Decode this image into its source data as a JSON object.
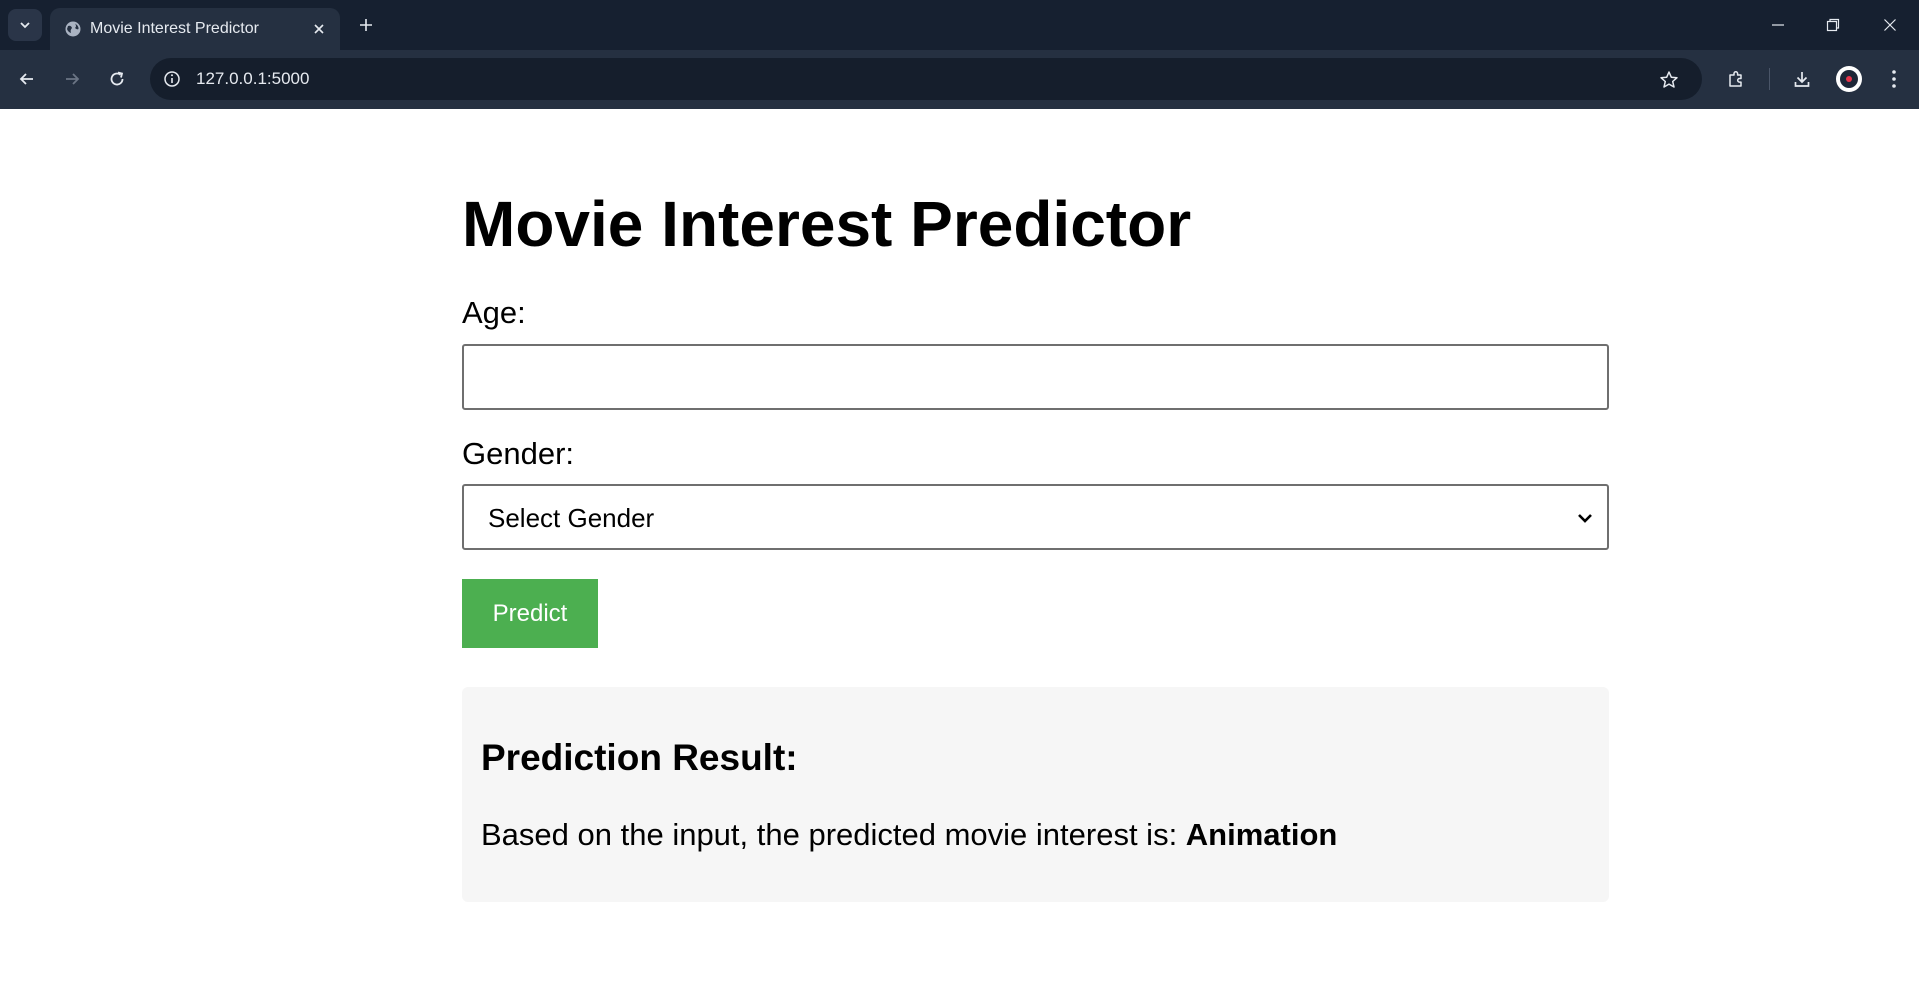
{
  "browser": {
    "tab": {
      "title": "Movie Interest Predictor",
      "favicon": "globe-icon"
    },
    "address_bar": {
      "url": "127.0.0.1:5000"
    },
    "icons": {
      "tab_search": "chevron-down-icon",
      "tab_close": "close-icon",
      "new_tab": "plus-icon",
      "minimize": "minimize-icon",
      "restore": "restore-icon",
      "close_window": "close-icon",
      "back": "arrow-left-icon",
      "forward": "arrow-right-icon",
      "reload": "reload-icon",
      "site_info": "info-icon",
      "bookmark": "star-icon",
      "extensions": "puzzle-icon",
      "downloads": "download-icon",
      "profile": "avatar-icon",
      "menu": "kebab-menu-icon"
    }
  },
  "page": {
    "title": "Movie Interest Predictor",
    "form": {
      "age_label": "Age:",
      "age_value": "",
      "gender_label": "Gender:",
      "gender_selected": "Select Gender",
      "predict_label": "Predict"
    },
    "result": {
      "title": "Prediction Result:",
      "text_prefix": "Based on the input, the predicted movie interest is: ",
      "value": "Animation"
    }
  },
  "colors": {
    "chrome_dark": "#162030",
    "chrome_toolbar": "#253041",
    "button_green": "#4caf50",
    "result_background": "#f6f6f6"
  }
}
